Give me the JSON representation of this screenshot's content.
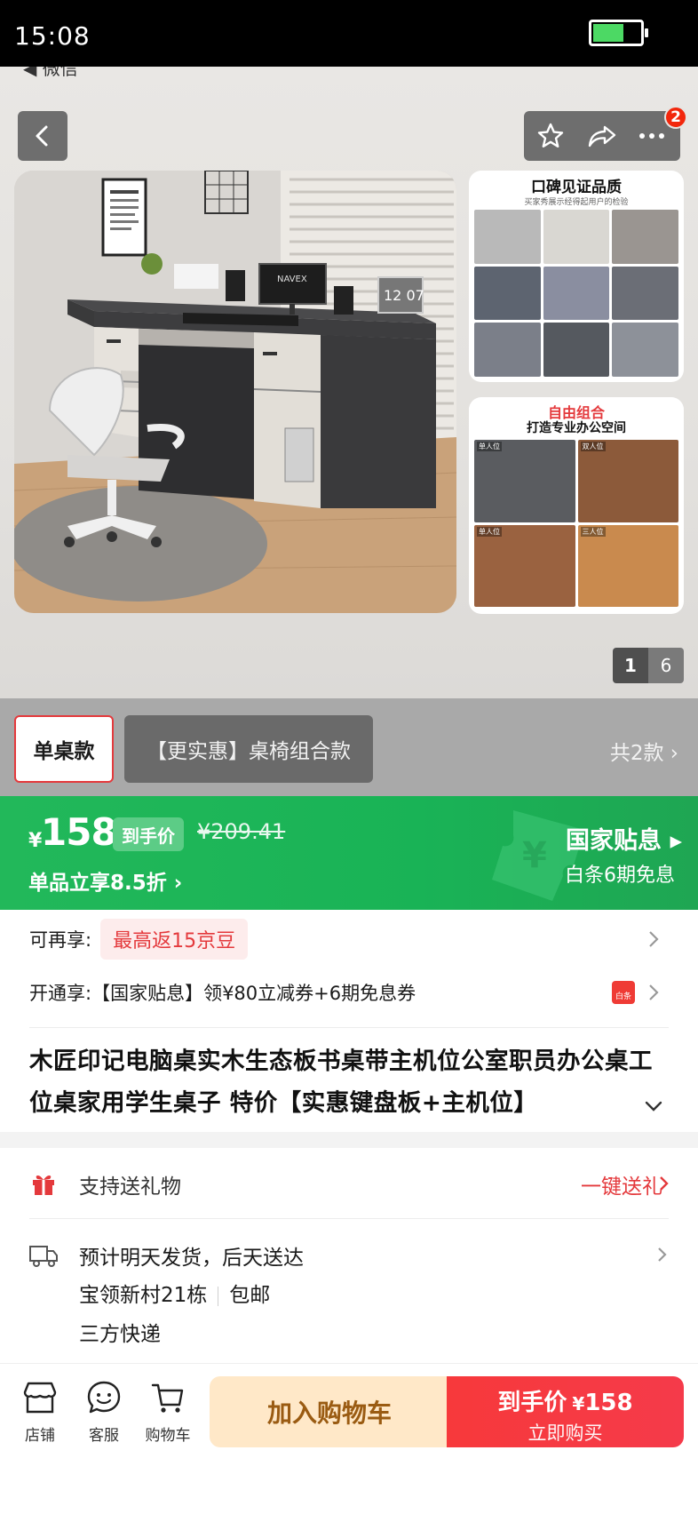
{
  "status_bar": {
    "time": "15:08",
    "battery_percent": 65
  },
  "header": {
    "wechat_back_label": "微信",
    "cart_badge_count": "2"
  },
  "gallery": {
    "thumb1": {
      "title": "口碑见证品质",
      "subtitle": "买家秀展示经得起用户的检验"
    },
    "thumb2": {
      "title_red": "自由组合",
      "title": "打造专业办公空间",
      "tags": [
        "单人位",
        "双人位",
        "单人位",
        "三人位"
      ]
    },
    "monitor_text": "NAVEX",
    "laptop_time": "12 07",
    "page_current": "1",
    "page_total": "6"
  },
  "variants": {
    "options": [
      "单桌款",
      "【更实惠】桌椅组合款"
    ],
    "selected_index": 0,
    "count_label": "共2款"
  },
  "price": {
    "currency": "¥",
    "amount": "158",
    "tag": "到手价",
    "original": "¥209.41",
    "discount": "单品立享8.5折",
    "gov_subsidy": "国家贴息",
    "installment": "白条6期免息"
  },
  "promotions": {
    "row1_label": "可再享:",
    "row1_pill": "最高返15京豆",
    "row2_text": "开通享:【国家贴息】领¥80立减券+6期免息券",
    "row2_icon": "白条"
  },
  "product": {
    "title": "木匠印记电脑桌实木生态板书桌带主机位公室职员办公桌工位桌家用学生桌子 特价【实惠键盘板+主机位】"
  },
  "services": {
    "gift_text": "支持送礼物",
    "gift_link": "一键送礼",
    "shipping_line1": "预计明天发货，后天送达",
    "address": "宝领新村21栋",
    "shipping_fee": "包邮",
    "courier": "三方快递"
  },
  "bottom_bar": {
    "nav": [
      "店铺",
      "客服",
      "购物车"
    ],
    "add_to_cart": "加入购物车",
    "buy_price_label": "到手价",
    "buy_currency": "¥",
    "buy_price": "158",
    "buy_now": "立即购买"
  },
  "colors": {
    "accent_red": "#e4393c",
    "subsidy_green": "#19b356",
    "cart_orange": "#ffe8c8"
  }
}
